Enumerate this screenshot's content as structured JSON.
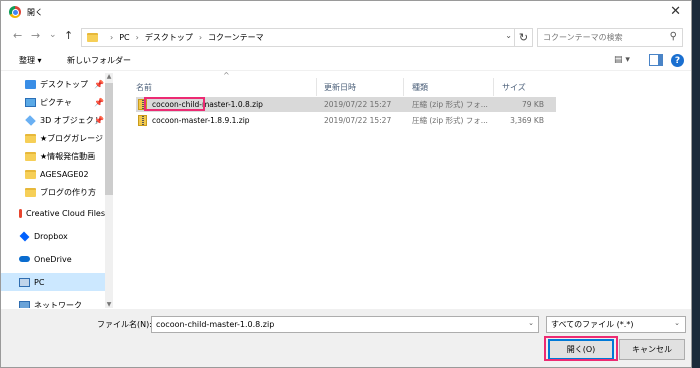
{
  "window": {
    "title": "開く"
  },
  "nav": {
    "back_label": "←",
    "forward_label": "→",
    "history_label": "⌄",
    "up_label": "↑",
    "breadcrumb": [
      "PC",
      "デスクトップ",
      "コクーンテーマ"
    ],
    "refresh_label": "↻",
    "search_placeholder": "コクーンテーマの検索"
  },
  "toolbar": {
    "organize": "整理 ▾",
    "new_folder": "新しいフォルダー",
    "help": "?"
  },
  "sidebar": {
    "items": [
      {
        "label": "デスクトップ",
        "icon": "desktop-icon",
        "pinned": true
      },
      {
        "label": "ピクチャ",
        "icon": "pictures-icon",
        "pinned": true
      },
      {
        "label": "3D オブジェクト",
        "icon": "3d-objects-icon",
        "pinned": true
      },
      {
        "label": "★ブログガレージ",
        "icon": "folder-icon",
        "pinned": false
      },
      {
        "label": "★情報発信動画",
        "icon": "folder-icon",
        "pinned": false
      },
      {
        "label": "AGESAGE02",
        "icon": "folder-icon",
        "pinned": false
      },
      {
        "label": "ブログの作り方",
        "icon": "folder-icon",
        "pinned": false
      },
      {
        "label": "Creative Cloud Files",
        "icon": "creative-cloud-icon",
        "pinned": false
      },
      {
        "label": "Dropbox",
        "icon": "dropbox-icon",
        "pinned": false
      },
      {
        "label": "OneDrive",
        "icon": "onedrive-icon",
        "pinned": false
      },
      {
        "label": "PC",
        "icon": "pc-icon",
        "pinned": false,
        "selected": true
      },
      {
        "label": "ネットワーク",
        "icon": "network-icon",
        "pinned": false
      }
    ],
    "pin_glyph": "📌"
  },
  "columns": {
    "name": "名前",
    "date": "更新日時",
    "type": "種類",
    "size": "サイズ"
  },
  "files": [
    {
      "name": "cocoon-child-master-1.0.8.zip",
      "date": "2019/07/22 15:27",
      "type": "圧縮 (zip 形式) フォ...",
      "size": "79 KB",
      "selected": true
    },
    {
      "name": "cocoon-master-1.8.9.1.zip",
      "date": "2019/07/22 15:27",
      "type": "圧縮 (zip 形式) フォ...",
      "size": "3,369 KB",
      "selected": false
    }
  ],
  "footer": {
    "filename_label": "ファイル名(N):",
    "filename_value": "cocoon-child-master-1.0.8.zip",
    "filetype_value": "すべてのファイル (*.*)",
    "open_label": "開く(O)",
    "cancel_label": "キャンセル"
  },
  "colors": {
    "selection": "#cce8ff",
    "highlight": "#ec2b73",
    "accent": "#0078d7"
  }
}
